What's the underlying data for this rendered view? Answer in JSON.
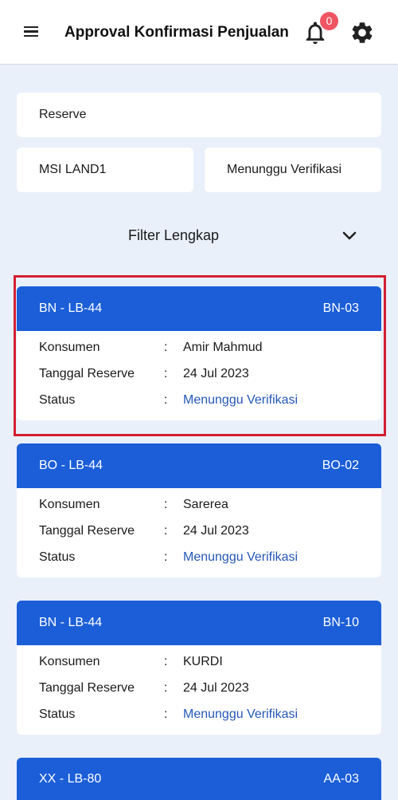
{
  "header": {
    "title": "Approval Konfirmasi Penjualan",
    "notification_count": "0"
  },
  "filters": {
    "type": "Reserve",
    "project": "MSI LAND1",
    "status": "Menunggu Verifikasi",
    "filter_label": "Filter Lengkap"
  },
  "labels": {
    "konsumen": "Konsumen",
    "tanggal": "Tanggal Reserve",
    "status": "Status",
    "colon": ":"
  },
  "cards": [
    {
      "unit": "BN - LB-44",
      "code": "BN-03",
      "konsumen": "Amir Mahmud",
      "tanggal": "24 Jul 2023",
      "status": "Menunggu Verifikasi"
    },
    {
      "unit": "BO - LB-44",
      "code": "BO-02",
      "konsumen": "Sarerea",
      "tanggal": "24 Jul 2023",
      "status": "Menunggu Verifikasi"
    },
    {
      "unit": "BN - LB-44",
      "code": "BN-10",
      "konsumen": "KURDI",
      "tanggal": "24 Jul 2023",
      "status": "Menunggu Verifikasi"
    },
    {
      "unit": "XX - LB-80",
      "code": "AA-03"
    }
  ],
  "colors": {
    "accent": "#1b5ed8",
    "status_text": "#2457b8",
    "badge": "#ef5563",
    "highlight": "#d32030",
    "background": "#e9f0fa"
  }
}
